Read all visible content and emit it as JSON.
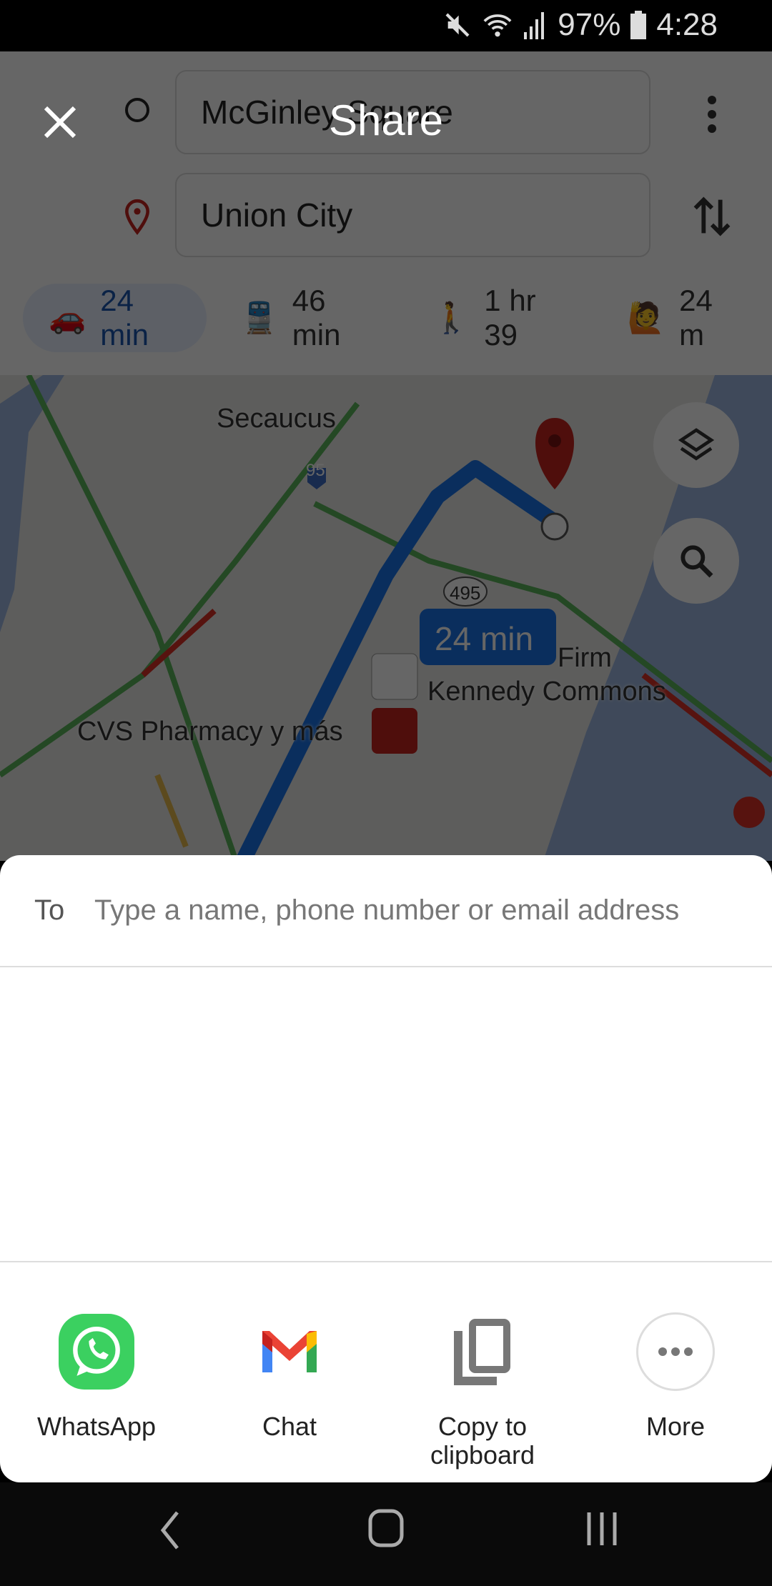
{
  "status_bar": {
    "battery": "97%",
    "time": "4:28",
    "icons": [
      "mute-icon",
      "wifi-icon",
      "signal-icon",
      "battery-icon"
    ]
  },
  "directions": {
    "origin": "McGinley Square",
    "destination": "Union City",
    "modes": [
      {
        "icon": "car-icon",
        "label": "24 min",
        "active": true
      },
      {
        "icon": "train-icon",
        "label": "46 min"
      },
      {
        "icon": "walk-icon",
        "label": "1 hr 39"
      },
      {
        "icon": "ride-icon",
        "label": "24 m"
      }
    ]
  },
  "map": {
    "labels": {
      "secaucus": "Secaucus",
      "i95": "95",
      "r495": "495",
      "route_time": "24 min",
      "mattress": "Firm",
      "kennedy": "Kennedy Commons",
      "cvs": "CVS Pharmacy y más"
    },
    "route_color": "#1a73e8",
    "pin_color": "#c5221f"
  },
  "share": {
    "title": "Share",
    "to_label": "To",
    "to_placeholder": "Type a name, phone number or email address",
    "targets": [
      {
        "icon": "whatsapp-icon",
        "label": "WhatsApp"
      },
      {
        "icon": "gmail-icon",
        "label": "Chat"
      },
      {
        "icon": "copy-icon",
        "label": "Copy to clipboard"
      },
      {
        "icon": "more-icon",
        "label": "More"
      }
    ]
  }
}
